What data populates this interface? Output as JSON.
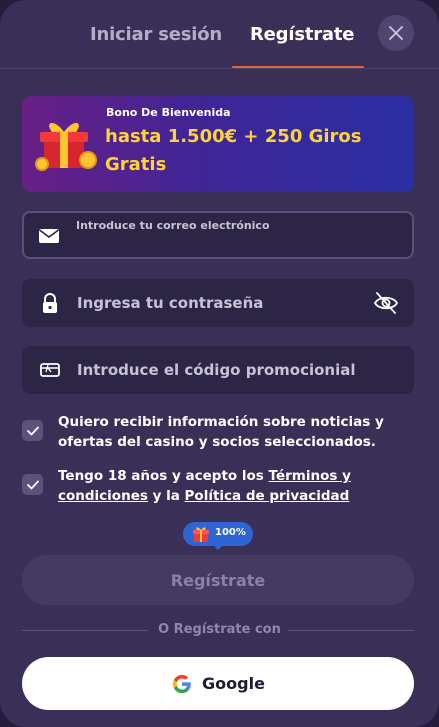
{
  "tabs": {
    "login": "Iniciar sesión",
    "register": "Regístrate"
  },
  "banner": {
    "subtitle": "Bono De Bienvenida",
    "title": "hasta 1.500€ + 250 Giros Gratis"
  },
  "form": {
    "email_placeholder": "Introduce tu correo electrónico",
    "password_placeholder": "Ingresa tu contraseña",
    "promo_placeholder": "Introduce el código promocionial"
  },
  "consents": {
    "marketing": "Quiero recibir información sobre noticias y ofertas del casino y socios seleccionados.",
    "age_prefix": "Tengo 18 años y acepto los ",
    "terms_link": "Términos y condiciones",
    "age_middle": " y la ",
    "privacy_link": "Política de privacidad"
  },
  "progress": {
    "percent_label": "100%"
  },
  "buttons": {
    "submit": "Regístrate",
    "google": "Google"
  },
  "divider": "O Regístrate con",
  "colors": {
    "accent": "#e0663c",
    "banner_text": "#ffd23a",
    "bubble": "#2f64d3"
  }
}
